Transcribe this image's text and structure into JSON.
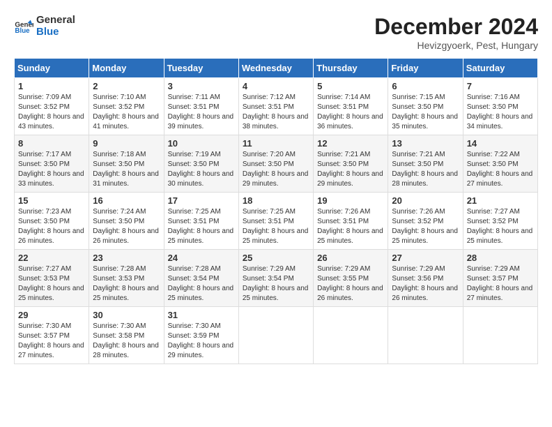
{
  "header": {
    "logo_line1": "General",
    "logo_line2": "Blue",
    "month_title": "December 2024",
    "location": "Hevizgyoerk, Pest, Hungary"
  },
  "days_of_week": [
    "Sunday",
    "Monday",
    "Tuesday",
    "Wednesday",
    "Thursday",
    "Friday",
    "Saturday"
  ],
  "weeks": [
    [
      {
        "day": "1",
        "sunrise": "7:09 AM",
        "sunset": "3:52 PM",
        "daylight": "8 hours and 43 minutes."
      },
      {
        "day": "2",
        "sunrise": "7:10 AM",
        "sunset": "3:52 PM",
        "daylight": "8 hours and 41 minutes."
      },
      {
        "day": "3",
        "sunrise": "7:11 AM",
        "sunset": "3:51 PM",
        "daylight": "8 hours and 39 minutes."
      },
      {
        "day": "4",
        "sunrise": "7:12 AM",
        "sunset": "3:51 PM",
        "daylight": "8 hours and 38 minutes."
      },
      {
        "day": "5",
        "sunrise": "7:14 AM",
        "sunset": "3:51 PM",
        "daylight": "8 hours and 36 minutes."
      },
      {
        "day": "6",
        "sunrise": "7:15 AM",
        "sunset": "3:50 PM",
        "daylight": "8 hours and 35 minutes."
      },
      {
        "day": "7",
        "sunrise": "7:16 AM",
        "sunset": "3:50 PM",
        "daylight": "8 hours and 34 minutes."
      }
    ],
    [
      {
        "day": "8",
        "sunrise": "7:17 AM",
        "sunset": "3:50 PM",
        "daylight": "8 hours and 33 minutes."
      },
      {
        "day": "9",
        "sunrise": "7:18 AM",
        "sunset": "3:50 PM",
        "daylight": "8 hours and 31 minutes."
      },
      {
        "day": "10",
        "sunrise": "7:19 AM",
        "sunset": "3:50 PM",
        "daylight": "8 hours and 30 minutes."
      },
      {
        "day": "11",
        "sunrise": "7:20 AM",
        "sunset": "3:50 PM",
        "daylight": "8 hours and 29 minutes."
      },
      {
        "day": "12",
        "sunrise": "7:21 AM",
        "sunset": "3:50 PM",
        "daylight": "8 hours and 29 minutes."
      },
      {
        "day": "13",
        "sunrise": "7:21 AM",
        "sunset": "3:50 PM",
        "daylight": "8 hours and 28 minutes."
      },
      {
        "day": "14",
        "sunrise": "7:22 AM",
        "sunset": "3:50 PM",
        "daylight": "8 hours and 27 minutes."
      }
    ],
    [
      {
        "day": "15",
        "sunrise": "7:23 AM",
        "sunset": "3:50 PM",
        "daylight": "8 hours and 26 minutes."
      },
      {
        "day": "16",
        "sunrise": "7:24 AM",
        "sunset": "3:50 PM",
        "daylight": "8 hours and 26 minutes."
      },
      {
        "day": "17",
        "sunrise": "7:25 AM",
        "sunset": "3:51 PM",
        "daylight": "8 hours and 25 minutes."
      },
      {
        "day": "18",
        "sunrise": "7:25 AM",
        "sunset": "3:51 PM",
        "daylight": "8 hours and 25 minutes."
      },
      {
        "day": "19",
        "sunrise": "7:26 AM",
        "sunset": "3:51 PM",
        "daylight": "8 hours and 25 minutes."
      },
      {
        "day": "20",
        "sunrise": "7:26 AM",
        "sunset": "3:52 PM",
        "daylight": "8 hours and 25 minutes."
      },
      {
        "day": "21",
        "sunrise": "7:27 AM",
        "sunset": "3:52 PM",
        "daylight": "8 hours and 25 minutes."
      }
    ],
    [
      {
        "day": "22",
        "sunrise": "7:27 AM",
        "sunset": "3:53 PM",
        "daylight": "8 hours and 25 minutes."
      },
      {
        "day": "23",
        "sunrise": "7:28 AM",
        "sunset": "3:53 PM",
        "daylight": "8 hours and 25 minutes."
      },
      {
        "day": "24",
        "sunrise": "7:28 AM",
        "sunset": "3:54 PM",
        "daylight": "8 hours and 25 minutes."
      },
      {
        "day": "25",
        "sunrise": "7:29 AM",
        "sunset": "3:54 PM",
        "daylight": "8 hours and 25 minutes."
      },
      {
        "day": "26",
        "sunrise": "7:29 AM",
        "sunset": "3:55 PM",
        "daylight": "8 hours and 26 minutes."
      },
      {
        "day": "27",
        "sunrise": "7:29 AM",
        "sunset": "3:56 PM",
        "daylight": "8 hours and 26 minutes."
      },
      {
        "day": "28",
        "sunrise": "7:29 AM",
        "sunset": "3:57 PM",
        "daylight": "8 hours and 27 minutes."
      }
    ],
    [
      {
        "day": "29",
        "sunrise": "7:30 AM",
        "sunset": "3:57 PM",
        "daylight": "8 hours and 27 minutes."
      },
      {
        "day": "30",
        "sunrise": "7:30 AM",
        "sunset": "3:58 PM",
        "daylight": "8 hours and 28 minutes."
      },
      {
        "day": "31",
        "sunrise": "7:30 AM",
        "sunset": "3:59 PM",
        "daylight": "8 hours and 29 minutes."
      },
      null,
      null,
      null,
      null
    ]
  ]
}
